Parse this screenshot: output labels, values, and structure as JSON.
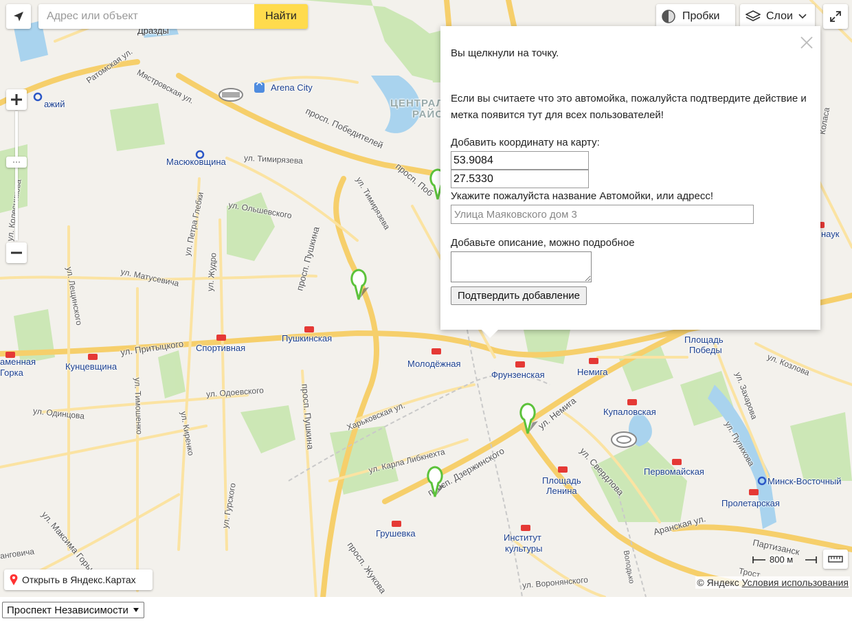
{
  "search": {
    "placeholder": "Адрес или объект",
    "button_label": "Найти"
  },
  "controls": {
    "traffic_label": "Пробки",
    "layers_label": "Слои",
    "open_yandex_label": "Открыть в Яндекс.Картах"
  },
  "scale": {
    "label": "800 м"
  },
  "copyright": {
    "brand": "© Яндекс",
    "terms_link": "Условия использования"
  },
  "balloon": {
    "line1": "Вы щелкнули на точку.",
    "line2": "Если вы считаете что это автомойка, пожалуйста подтвердите действие и метка появится тут для всех пользователей!",
    "coords_label": "Добавить координату на карту:",
    "lat": "53.9084",
    "lon": "27.5330",
    "name_label": "Укажите пожалуйста название Автомойки, или адресс!",
    "name_placeholder": "Улица Маяковского дом 3",
    "desc_label": "Добавьте описание, можно подробное",
    "confirm_label": "Подтвердить добавление"
  },
  "street_select": {
    "selected": "Проспект Независимости"
  },
  "map_labels": {
    "drazdy": "Дразды",
    "arena": "Arena City",
    "masyukovshchina": "Масюковщина",
    "timiryazeva": "ул. Тимирязева",
    "olshevskogo": "ул. Ольшевского",
    "matusevicha": "ул. Матусевича",
    "pritytskogo": "ул. Притыцкого",
    "sportivnaya": "Спортивная",
    "pushkinskaya": "Пушкинская",
    "molodezhnaya": "Молодёжная",
    "frunzenskaya": "Фрунзенская",
    "nemiga": "Немига",
    "kupalovskaya": "Купаловская",
    "pervomayskaya": "Первомайская",
    "proletarskaya": "Пролетарская",
    "minsk_vostochny": "Минск-Восточный",
    "ploshchad_lenina_1": "Площадь",
    "ploshchad_lenina_2": "Ленина",
    "ploshchad_pobedy_1": "Площадь",
    "ploshchad_pobedy_2": "Победы",
    "grushevka": "Грушевка",
    "institut_1": "Институт",
    "institut_2": "культуры",
    "kuntsevshchina": "Кунцевщина",
    "kamennaya_1": "аменная",
    "kamennaya_2": "Горка",
    "odoevskogo": "ул. Одоевского",
    "odintsova": "ул. Одинцова",
    "kharkovskaya": "Харьковская ул.",
    "karla_libknekhta": "ул. Карла Либкнехта",
    "dzerzhinskogo": "просп. Дзержинского",
    "nemiga_st": "ул. Немига",
    "sverdlova": "ул. Свердлова",
    "aranskaya": "Аранская ул.",
    "kozlova": "ул. Козлова",
    "pobediteley": "просп. Победителей",
    "pushkina": "просп. Пушкина",
    "central_1": "ЦЕНТРАЛ",
    "central_2": "РАЙО",
    "ratomskaya": "Ратомская ул.",
    "mstrovskaya": "Мястровская ул.",
    "zhudro": "ул. Жудро",
    "petra_glebki": "ул. Петра Глебки",
    "kolesnikova": "ул. Колесникова",
    "leshchinskogo": "ул. Лещинского",
    "timoshenko": "ул. Тимошенко",
    "kirenko": "ул. Киренко",
    "gurskogo": "ул. Гурского",
    "maxima_gorkogo": "ул. Максима Горького",
    "zhukova": "просп. Жукова",
    "voronyanskogo": "ул. Воронянского",
    "zakharova": "ул. Захарова",
    "pulikhova": "ул. Пулихова",
    "partizansky": "Партизанск",
    "zhukovka": "Жукови",
    "nauki": "наук",
    "kolasa": "Коласа",
    "volodko": "Володько",
    "yazhy": "ажий",
    "gorkogo_end": "анговича",
    "timiryazeva2": "ул. Тимирязева",
    "pobediteley2": "просп. Поб",
    "yakuba": "ул. Кола",
    "sovetskaya": "Трост"
  }
}
